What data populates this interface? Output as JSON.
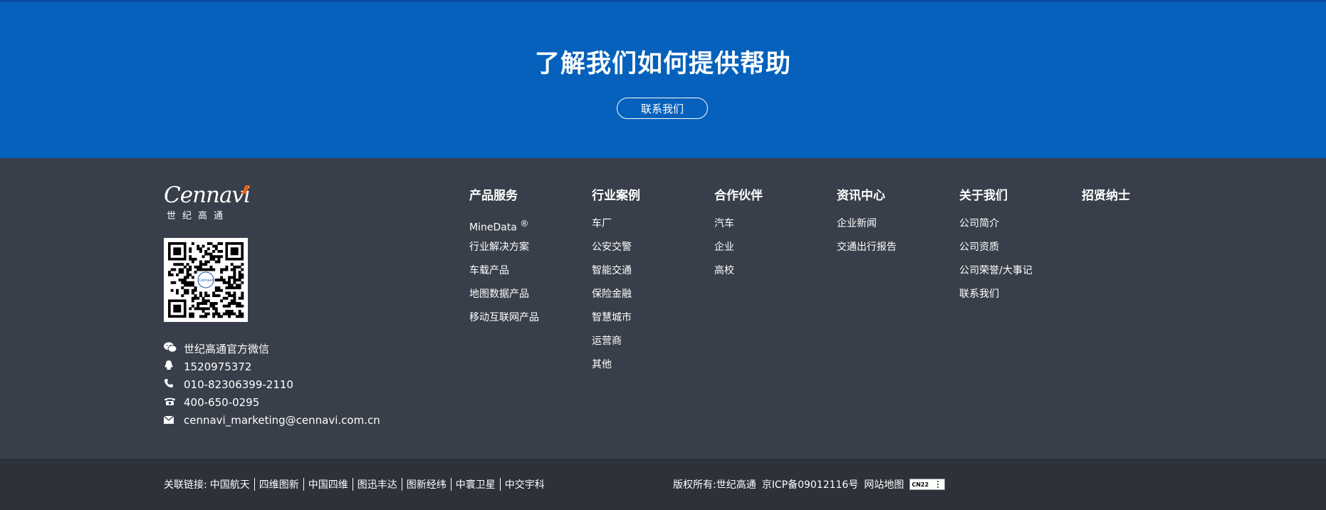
{
  "cta": {
    "title": "了解我们如何提供帮助",
    "button": "联系我们"
  },
  "logo": {
    "word": "Cennavi",
    "sub": "世纪高通"
  },
  "contacts": [
    {
      "icon": "wechat-icon",
      "text": "世纪高通官方微信"
    },
    {
      "icon": "qq-icon",
      "text": "1520975372"
    },
    {
      "icon": "phone-icon",
      "text": "010-82306399-2110"
    },
    {
      "icon": "telephone-icon",
      "text": "400-650-0295"
    },
    {
      "icon": "mail-icon",
      "text": "cennavi_marketing@cennavi.com.cn"
    }
  ],
  "columns": [
    {
      "title": "产品服务",
      "items": [
        "MineData",
        "行业解决方案",
        "车载产品",
        "地图数据产品",
        "移动互联网产品"
      ],
      "sup": "®"
    },
    {
      "title": "行业案例",
      "items": [
        "车厂",
        "公安交警",
        "智能交通",
        "保险金融",
        "智慧城市",
        "运营商",
        "其他"
      ]
    },
    {
      "title": "合作伙伴",
      "items": [
        "汽车",
        "企业",
        "高校"
      ]
    },
    {
      "title": "资讯中心",
      "items": [
        "企业新闻",
        "交通出行报告"
      ]
    },
    {
      "title": "关于我们",
      "items": [
        "公司简介",
        "公司资质",
        "公司荣誉/大事记",
        "联系我们"
      ]
    },
    {
      "title": "招贤纳士",
      "items": []
    }
  ],
  "bottom": {
    "links_label": "关联链接:",
    "links": [
      "中国航天",
      "四维图新",
      "中国四维",
      "图迅丰达",
      "图新经纬",
      "中寰卫星",
      "中交宇科"
    ],
    "copyright": "版权所有:世纪高通",
    "icp": "京ICP备09012116号",
    "sitemap": "网站地图",
    "badge": "CN22"
  },
  "colors": {
    "cta_bg": "#0561bb",
    "footer_bg": "#383f4a",
    "bottom_bg": "#2c313a",
    "logo_accent": "#e6621d"
  }
}
